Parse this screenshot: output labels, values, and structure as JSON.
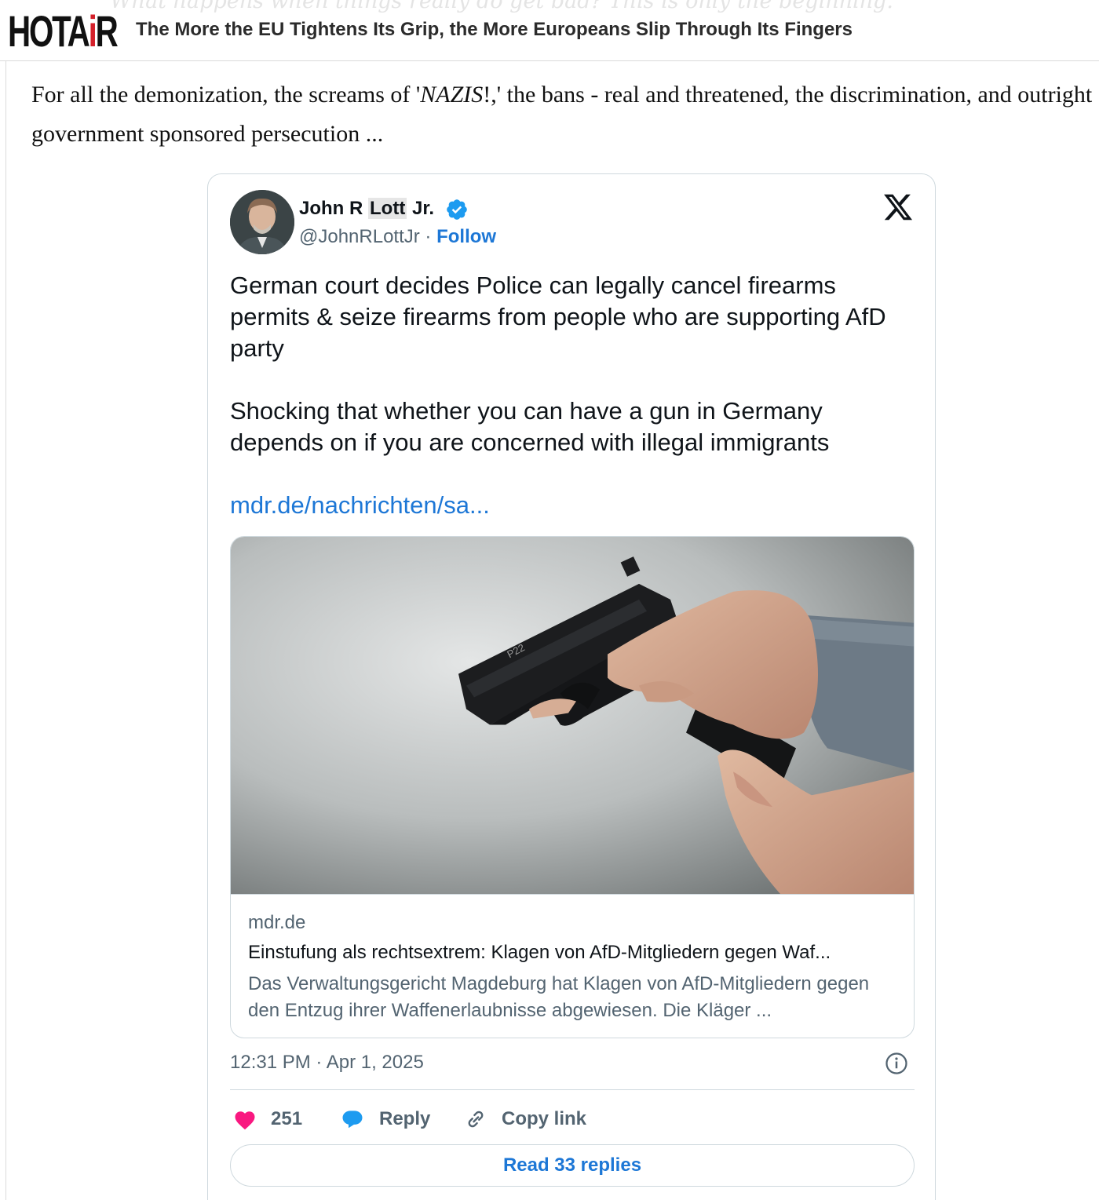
{
  "header": {
    "ghost_text": "What happens when things really do get bad? This is only the beginning.",
    "logo_text": "HOTAiR",
    "title": "The More the EU Tightens Its Grip, the More Europeans Slip Through Its Fingers"
  },
  "article": {
    "intro_before": "For all the demonization, the screams of '",
    "intro_em": "NAZIS",
    "intro_after": "!,' the bans - real and threatened, the discrimination, and outright government sponsored persecution ..."
  },
  "tweet": {
    "author": {
      "name_first": "John R ",
      "name_highlight": "Lott",
      "name_last": " Jr.",
      "handle": "@JohnRLottJr",
      "separator": " · ",
      "follow_label": "Follow"
    },
    "paragraph1": "German court decides Police can legally cancel firearms permits & seize firearms from people who are supporting AfD party",
    "paragraph2": "Shocking that whether you can have a gun in Germany depends on if you are concerned with illegal immigrants",
    "link_text": "mdr.de/nachrichten/sa...",
    "card": {
      "domain": "mdr.de",
      "title": "Einstufung als rechtsextrem: Klagen von AfD-Mitgliedern gegen Waf...",
      "description": "Das Verwaltungsgericht Magdeburg hat Klagen von AfD-Mitgliedern gegen den Entzug ihrer Waffenerlaubnisse abgewiesen. Die Kläger ...",
      "image_gun_label": "P22"
    },
    "timestamp": "12:31 PM · Apr 1, 2025",
    "actions": {
      "likes": "251",
      "reply_label": "Reply",
      "copy_label": "Copy link"
    },
    "read_replies_label": "Read 33 replies"
  },
  "colors": {
    "accent_blue": "#1d77d6",
    "like_pink": "#f91880",
    "logo_red": "#d4202a",
    "muted_text": "#536471"
  },
  "icons": [
    "verified-badge-icon",
    "x-logo-icon",
    "info-icon",
    "heart-icon",
    "reply-bubble-icon",
    "link-icon"
  ]
}
